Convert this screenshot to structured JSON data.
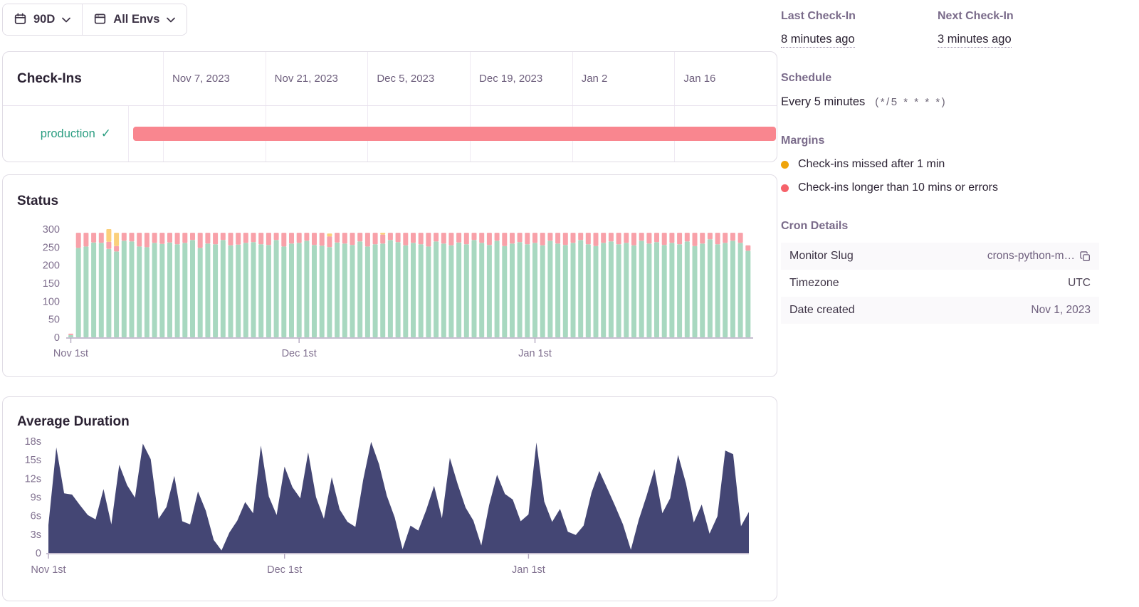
{
  "filter_bar": {
    "date_range": {
      "icon": "calendar-icon",
      "label": "90D"
    },
    "environment": {
      "icon": "window-icon",
      "label": "All Envs"
    }
  },
  "checkins": {
    "title": "Check-Ins",
    "date_columns": [
      "Nov 7, 2023",
      "Nov 21, 2023",
      "Dec 5, 2023",
      "Dec 19, 2023",
      "Jan 2",
      "Jan 16"
    ],
    "rows": [
      {
        "environment": "production",
        "status_icon": "check-icon",
        "bar_color": "#f9868f"
      }
    ]
  },
  "chart_data": [
    {
      "type": "bar",
      "stacked": true,
      "title": "Status",
      "ylim": [
        0,
        300
      ],
      "y_ticks": [
        0,
        50,
        100,
        150,
        200,
        250,
        300
      ],
      "x_tick_labels": [
        "Nov 1st",
        "Dec 1st",
        "Jan 1st"
      ],
      "x_tick_indices": [
        0,
        30,
        61
      ],
      "grid": false,
      "series": [
        {
          "name": "ok",
          "color": "#a8d8c0",
          "values": [
            6,
            248,
            252,
            263,
            262,
            245,
            238,
            268,
            266,
            252,
            250,
            262,
            259,
            263,
            258,
            262,
            270,
            248,
            260,
            258,
            270,
            255,
            257,
            262,
            264,
            258,
            256,
            270,
            252,
            260,
            262,
            268,
            256,
            254,
            250,
            263,
            260,
            256,
            266,
            252,
            258,
            260,
            270,
            264,
            255,
            262,
            258,
            252,
            266,
            260,
            255,
            263,
            258,
            270,
            262,
            256,
            268,
            253,
            260,
            264,
            258,
            262,
            255,
            268,
            260,
            256,
            262,
            270,
            258,
            253,
            262,
            266,
            258,
            262,
            255,
            268,
            260,
            264,
            256,
            262,
            258,
            266,
            253,
            260,
            272,
            258,
            262,
            268,
            262,
            240
          ]
        },
        {
          "name": "error",
          "color": "#f8a1a9",
          "values": [
            4,
            42,
            38,
            27,
            28,
            20,
            15,
            22,
            24,
            38,
            40,
            28,
            31,
            27,
            32,
            28,
            20,
            42,
            30,
            32,
            20,
            35,
            33,
            28,
            26,
            32,
            34,
            20,
            38,
            30,
            28,
            22,
            34,
            36,
            30,
            27,
            30,
            34,
            24,
            38,
            32,
            25,
            20,
            26,
            35,
            28,
            32,
            38,
            24,
            30,
            35,
            27,
            32,
            20,
            28,
            34,
            22,
            37,
            30,
            26,
            32,
            28,
            35,
            22,
            30,
            34,
            28,
            20,
            32,
            37,
            28,
            24,
            32,
            28,
            35,
            22,
            30,
            26,
            34,
            28,
            32,
            24,
            37,
            30,
            18,
            32,
            28,
            22,
            28,
            15
          ]
        },
        {
          "name": "missed",
          "color": "#fbd07b",
          "values": [
            0,
            0,
            0,
            0,
            0,
            35,
            37,
            0,
            0,
            0,
            0,
            0,
            0,
            0,
            0,
            0,
            0,
            0,
            0,
            0,
            0,
            0,
            0,
            0,
            0,
            0,
            0,
            0,
            0,
            0,
            0,
            0,
            0,
            0,
            8,
            0,
            0,
            0,
            0,
            0,
            0,
            5,
            0,
            0,
            0,
            0,
            0,
            0,
            0,
            0,
            0,
            0,
            0,
            0,
            0,
            0,
            0,
            0,
            0,
            0,
            0,
            0,
            0,
            0,
            0,
            0,
            0,
            0,
            0,
            0,
            0,
            0,
            0,
            0,
            0,
            0,
            0,
            0,
            0,
            0,
            0,
            0,
            0,
            0,
            0,
            0,
            0,
            0,
            0,
            0
          ]
        }
      ]
    },
    {
      "type": "area",
      "title": "Average Duration",
      "ylim": [
        0,
        18
      ],
      "y_tick_values": [
        0,
        3,
        6,
        9,
        12,
        15,
        18
      ],
      "y_tick_labels": [
        "0",
        "3s",
        "6s",
        "9s",
        "12s",
        "15s",
        "18s"
      ],
      "x_tick_labels": [
        "Nov 1st",
        "Dec 1st",
        "Jan 1st"
      ],
      "x_tick_indices": [
        0,
        30,
        61
      ],
      "grid": false,
      "color": "#444674",
      "values": [
        4.5,
        17,
        9.6,
        9.4,
        7.7,
        6.1,
        5.4,
        10.3,
        4.6,
        14.2,
        10.9,
        8.9,
        17.6,
        15.1,
        5.5,
        7.4,
        12.4,
        5.1,
        4.6,
        9.9,
        6.8,
        2.1,
        0.4,
        3.3,
        5.2,
        8.2,
        6.4,
        17.3,
        9.1,
        6.1,
        13.9,
        10.6,
        8.8,
        16.2,
        9.0,
        5.5,
        12.2,
        7.0,
        5.0,
        4.2,
        11.8,
        17.9,
        14.3,
        9.2,
        5.7,
        0.6,
        4.4,
        3.6,
        6.9,
        10.8,
        5.6,
        15.3,
        11.1,
        7.3,
        5.2,
        1.2,
        7.7,
        12.6,
        9.5,
        8.6,
        5.1,
        6.2,
        17.8,
        8.3,
        5.0,
        7.1,
        3.4,
        2.9,
        4.4,
        9.7,
        13.2,
        10.4,
        7.6,
        4.6,
        0.5,
        5.3,
        9.2,
        13.5,
        6.4,
        8.8,
        15.8,
        11.2,
        4.9,
        7.8,
        3.1,
        5.9,
        16.5,
        15.9,
        4.3,
        6.6
      ]
    }
  ],
  "sidebar": {
    "last_check_in": {
      "label": "Last Check-In",
      "value": "8 minutes ago"
    },
    "next_check_in": {
      "label": "Next Check-In",
      "value": "3 minutes ago"
    },
    "schedule": {
      "label": "Schedule",
      "value": "Every 5 minutes",
      "cron": "(*/5 * * * *)"
    },
    "margins": {
      "label": "Margins",
      "items": [
        {
          "icon": "yellow-dot-icon",
          "color": "#efa40a",
          "text": "Check-ins missed after 1 min"
        },
        {
          "icon": "red-dot-icon",
          "color": "#f6626a",
          "text": "Check-ins longer than 10 mins or errors"
        }
      ]
    },
    "cron_details": {
      "label": "Cron Details",
      "rows": [
        {
          "key": "Monitor Slug",
          "value": "crons-python-m…",
          "copy": true
        },
        {
          "key": "Timezone",
          "value": "UTC",
          "dark": true
        },
        {
          "key": "Date created",
          "value": "Nov 1, 2023"
        }
      ]
    }
  },
  "colors": {
    "accent_green": "#2a9d80",
    "timeline_bar": "#f9868f",
    "ok": "#a8d8c0",
    "error": "#f8a1a9",
    "missed": "#fbd07b",
    "duration_area": "#444674",
    "axis_line": "#b3a8c0"
  }
}
